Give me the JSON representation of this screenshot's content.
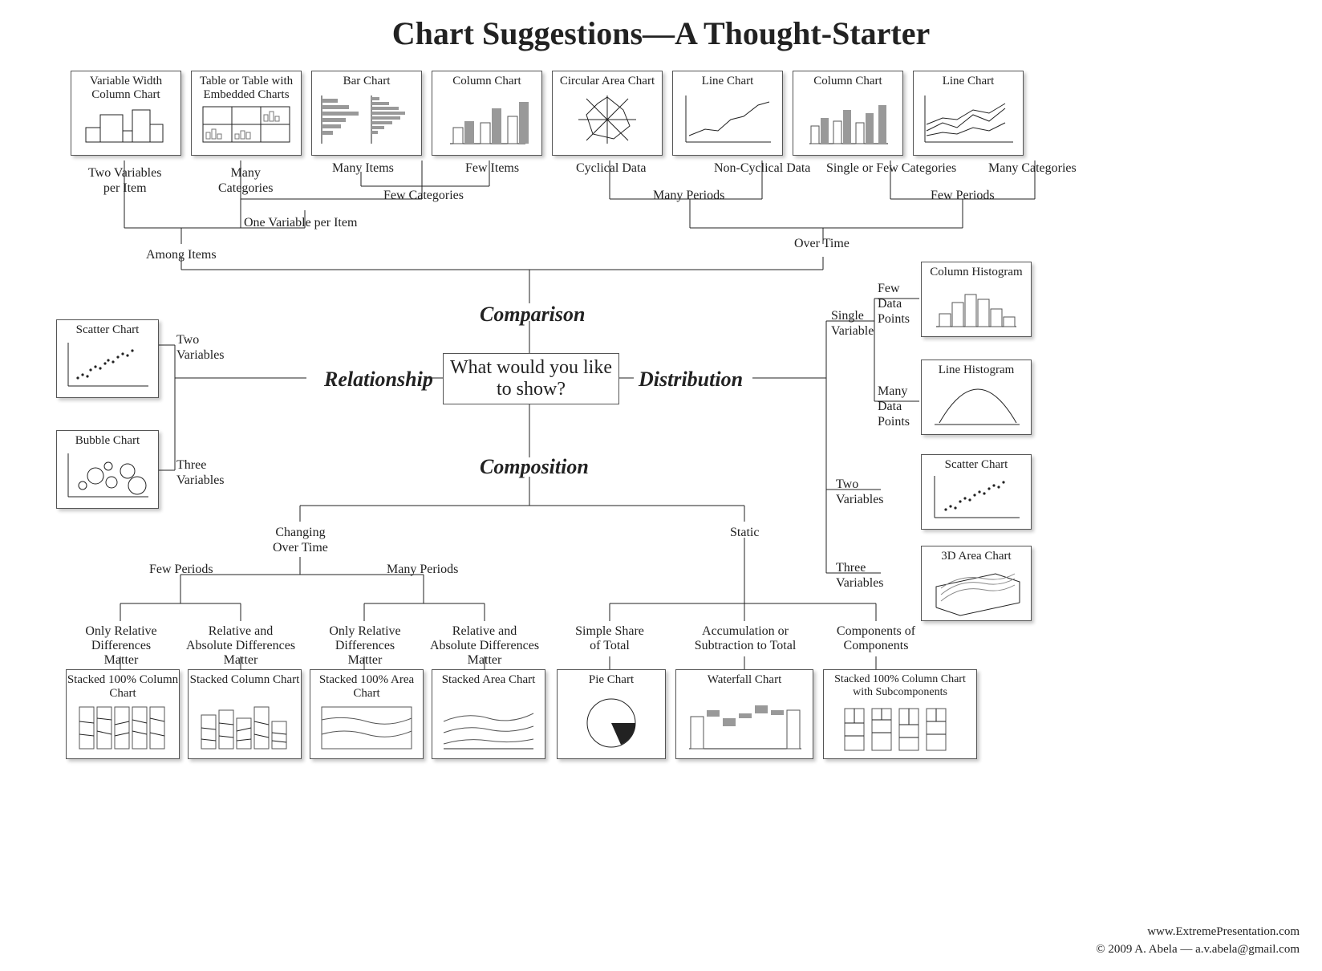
{
  "title": "Chart Suggestions—A Thought-Starter",
  "center": "What would you\nlike to show?",
  "branches": {
    "comparison": "Comparison",
    "relationship": "Relationship",
    "distribution": "Distribution",
    "composition": "Composition"
  },
  "labels": {
    "two_vars_per_item": "Two Variables\nper Item",
    "many_categories": "Many\nCategories",
    "many_items": "Many Items",
    "few_items": "Few Items",
    "few_categories": "Few Categories",
    "one_var_per_item": "One Variable per Item",
    "among_items": "Among Items",
    "cyclical": "Cyclical Data",
    "non_cyclical": "Non-Cyclical Data",
    "many_periods_top": "Many Periods",
    "single_few_cat": "Single or Few Categories",
    "many_categories_top": "Many Categories",
    "few_periods_top": "Few Periods",
    "over_time": "Over Time",
    "two_variables": "Two\nVariables",
    "three_variables": "Three\nVariables",
    "single_variable": "Single\nVariable",
    "few_data_points": "Few\nData\nPoints",
    "many_data_points": "Many\nData\nPoints",
    "two_variables_r": "Two\nVariables",
    "three_variables_r": "Three\nVariables",
    "changing_over_time": "Changing\nOver Time",
    "static": "Static",
    "few_periods": "Few Periods",
    "many_periods": "Many Periods",
    "only_rel_1": "Only Relative\nDifferences Matter",
    "rel_abs_1": "Relative and Absolute\nDifferences Matter",
    "only_rel_2": "Only Relative\nDifferences Matter",
    "rel_abs_2": "Relative and Absolute\nDifferences Matter",
    "simple_share": "Simple Share\nof Total",
    "accum": "Accumulation or\nSubtraction to Total",
    "comp_of_comp": "Components\nof Components"
  },
  "cards": {
    "var_width_column": "Variable Width\nColumn Chart",
    "table_embedded": "Table or Table with\nEmbedded Charts",
    "bar_chart": "Bar Chart",
    "column_chart": "Column Chart",
    "circular_area": "Circular Area Chart",
    "line_chart": "Line Chart",
    "column_chart_2": "Column Chart",
    "line_chart_2": "Line Chart",
    "scatter_chart": "Scatter Chart",
    "bubble_chart": "Bubble Chart",
    "column_histogram": "Column Histogram",
    "line_histogram": "Line Histogram",
    "scatter_chart_2": "Scatter Chart",
    "3d_area": "3D Area Chart",
    "stacked_100_col": "Stacked 100%\nColumn Chart",
    "stacked_col": "Stacked\nColumn Chart",
    "stacked_100_area": "Stacked 100%\nArea Chart",
    "stacked_area": "Stacked Area Chart",
    "pie_chart": "Pie Chart",
    "waterfall": "Waterfall Chart",
    "stacked_100_sub": "Stacked 100% Column Chart\nwith Subcomponents"
  },
  "credit": {
    "url": "www.ExtremePresentation.com",
    "copyright": "© 2009  A. Abela — a.v.abela@gmail.com"
  }
}
